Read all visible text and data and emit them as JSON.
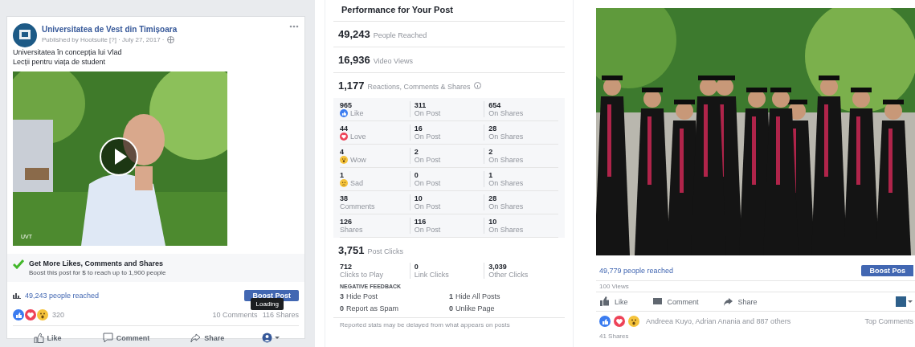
{
  "post": {
    "page_name": "Universitatea de Vest din Timișoara",
    "meta": "Published by Hootsuite [?] · July 27, 2017 · ",
    "text_lines": [
      "Universitatea în concepția lui Vlad",
      "Lecții pentru viața de student"
    ],
    "video": {
      "kind": "picture",
      "watermark": "UVT"
    },
    "promo": {
      "title": "Get More Likes, Comments and Shares",
      "subtitle": "Boost this post for $ to reach up to 1,900 people"
    },
    "reached": "49,243 people reached",
    "boost": "Boost Post",
    "tooltip": "Loading",
    "reaction_count": "320",
    "comments": "10 Comments",
    "shares": "116 Shares",
    "actions": [
      "Like",
      "Comment",
      "Share"
    ]
  },
  "performance": {
    "title": "Performance for Your Post",
    "summary": [
      {
        "value": "49,243",
        "label": "People Reached"
      },
      {
        "value": "16,936",
        "label": "Video Views"
      }
    ],
    "reactions_total": {
      "value": "1,177",
      "label": "Reactions, Comments & Shares"
    },
    "rows": [
      {
        "kind": "like",
        "cells": [
          {
            "value": "965",
            "label": "Like"
          },
          {
            "value": "311",
            "label": "On Post"
          },
          {
            "value": "654",
            "label": "On Shares"
          }
        ]
      },
      {
        "kind": "love",
        "cells": [
          {
            "value": "44",
            "label": "Love"
          },
          {
            "value": "16",
            "label": "On Post"
          },
          {
            "value": "28",
            "label": "On Shares"
          }
        ]
      },
      {
        "kind": "wow",
        "cells": [
          {
            "value": "4",
            "label": "Wow"
          },
          {
            "value": "2",
            "label": "On Post"
          },
          {
            "value": "2",
            "label": "On Shares"
          }
        ]
      },
      {
        "kind": "sad",
        "cells": [
          {
            "value": "1",
            "label": "Sad"
          },
          {
            "value": "0",
            "label": "On Post"
          },
          {
            "value": "1",
            "label": "On Shares"
          }
        ]
      },
      {
        "kind": "plain",
        "cells": [
          {
            "value": "38",
            "label": "Comments"
          },
          {
            "value": "10",
            "label": "On Post"
          },
          {
            "value": "28",
            "label": "On Shares"
          }
        ]
      },
      {
        "kind": "plain",
        "cells": [
          {
            "value": "126",
            "label": "Shares"
          },
          {
            "value": "116",
            "label": "On Post"
          },
          {
            "value": "10",
            "label": "On Shares"
          }
        ]
      }
    ],
    "clicks": {
      "value": "3,751",
      "label": "Post Clicks"
    },
    "click_cells": [
      {
        "value": "712",
        "label": "Clicks to Play"
      },
      {
        "value": "0",
        "label": "Link Clicks"
      },
      {
        "value": "3,039",
        "label": "Other Clicks"
      }
    ],
    "negative_title": "NEGATIVE FEEDBACK",
    "negative": [
      {
        "value": "3",
        "label": "Hide Post"
      },
      {
        "value": "1",
        "label": "Hide All Posts"
      },
      {
        "value": "0",
        "label": "Report as Spam"
      },
      {
        "value": "0",
        "label": "Unlike Page"
      }
    ],
    "footnote": "Reported stats may be delayed from what appears on posts"
  },
  "second_post": {
    "photo": {
      "kind": "picture"
    },
    "reached": "49,779 people reached",
    "boost": "Boost Pos",
    "views": "100 Views",
    "actions": [
      "Like",
      "Comment",
      "Share"
    ],
    "reactors": "Andreea Kuyo, Adrian Anania and 887 others",
    "top_comments": "Top Comments",
    "shares": "41 Shares"
  }
}
